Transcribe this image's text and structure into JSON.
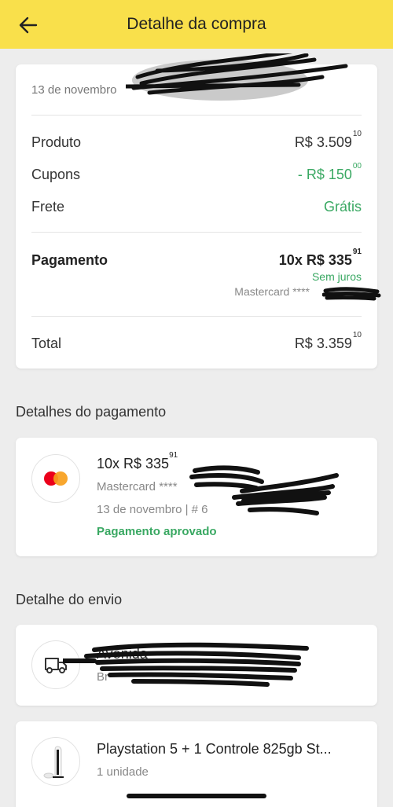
{
  "header": {
    "title": "Detalhe da compra",
    "back_icon": "arrow-left-icon"
  },
  "summary": {
    "date": "13 de novembro",
    "rows": [
      {
        "label": "Produto",
        "value_main": "R$ 3.509",
        "value_cents": "10"
      },
      {
        "label": "Cupons",
        "value_main": "- R$ 150",
        "value_cents": "00"
      },
      {
        "label": "Frete",
        "value_main": "Grátis",
        "value_cents": ""
      }
    ],
    "payment": {
      "label": "Pagamento",
      "installments_main": "10x R$ 335",
      "installments_cents": "91",
      "interest_note": "Sem juros",
      "card": "Mastercard ****"
    },
    "total": {
      "label": "Total",
      "value_main": "R$ 3.359",
      "value_cents": "10"
    }
  },
  "payment_details": {
    "section_title": "Detalhes do pagamento",
    "installments_main": "10x R$ 335",
    "installments_cents": "91",
    "card": "Mastercard ****",
    "date_order": "13 de novembro  |  # 6",
    "status": "Pagamento aprovado",
    "icon": "mastercard-icon",
    "colors": {
      "mc_red": "#eb001b",
      "mc_orange": "#f79e1b",
      "approved": "#39a862"
    }
  },
  "shipping": {
    "section_title": "Detalhe do envio",
    "icon": "truck-icon",
    "address_line1": "Avenida ",
    "address_line2": "Br"
  },
  "item": {
    "title": "Playstation 5 + 1 Controle 825gb St...",
    "quantity": "1 unidade",
    "icon": "ps5-console-icon"
  },
  "theme": {
    "header_bg": "#f9e04b",
    "background": "#ededed",
    "accent_green": "#39a862"
  }
}
